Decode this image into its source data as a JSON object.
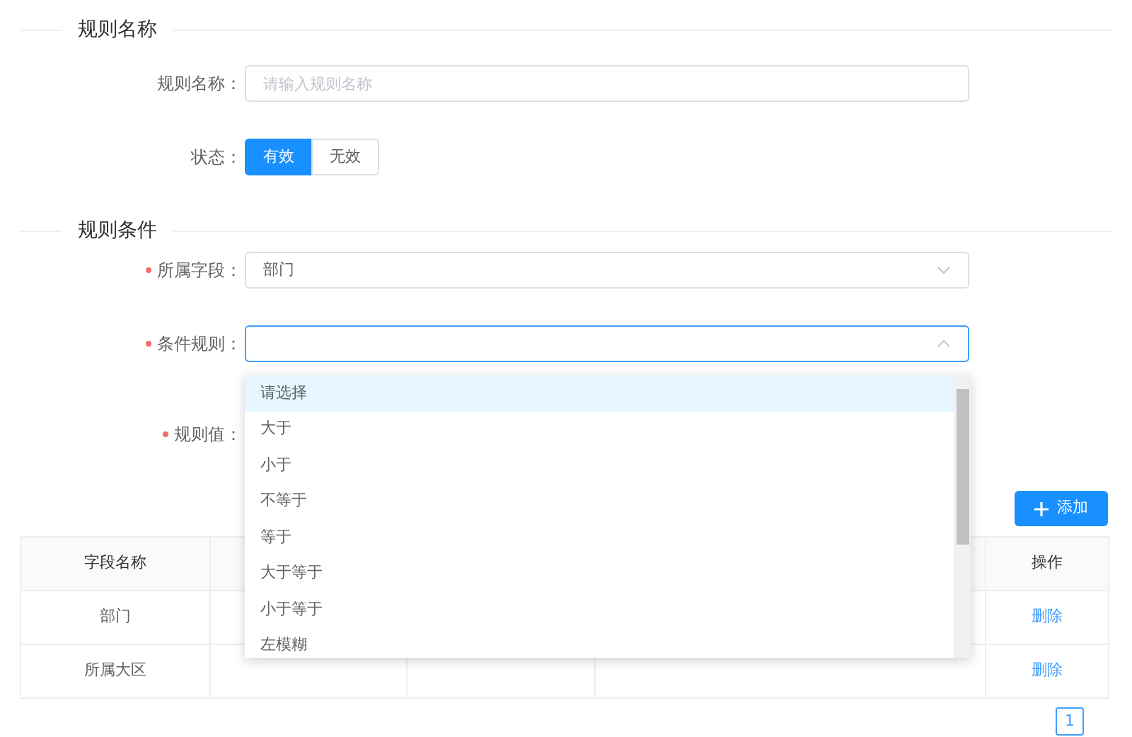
{
  "section_1": {
    "title": "规则名称"
  },
  "name_field": {
    "label": "规则名称：",
    "placeholder": "请输入规则名称"
  },
  "status": {
    "label": "状态：",
    "options": [
      {
        "label": "有效",
        "selected": true
      },
      {
        "label": "无效",
        "selected": false
      }
    ]
  },
  "section_2": {
    "title": "规则条件"
  },
  "field_select": {
    "label": "所属字段：",
    "value": "部门",
    "required": true,
    "expanded": false
  },
  "rule_select": {
    "label": "条件规则：",
    "required": true,
    "expanded": true,
    "options": [
      {
        "label": "请选择",
        "selected": true
      },
      {
        "label": "大于",
        "selected": false
      },
      {
        "label": "小于",
        "selected": false
      },
      {
        "label": "不等于",
        "selected": false
      },
      {
        "label": "等于",
        "selected": false
      },
      {
        "label": "大于等于",
        "selected": false
      },
      {
        "label": "小于等于",
        "selected": false
      },
      {
        "label": "左模糊",
        "selected": false
      }
    ]
  },
  "value_field": {
    "label": "规则值：",
    "required": true
  },
  "add_button": {
    "label": "添加"
  },
  "table": {
    "columns": {
      "column_1": "字段名称",
      "column_5": "操作"
    },
    "rows": [
      {
        "column_1": "部门",
        "column_5": "删除"
      },
      {
        "column_1": "所属大区",
        "column_5": "删除"
      }
    ]
  },
  "pagination": {
    "pages": [
      {
        "label": "1",
        "selected": true
      }
    ]
  }
}
